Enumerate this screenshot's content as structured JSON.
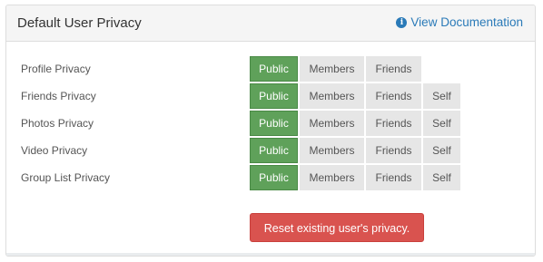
{
  "panel": {
    "title": "Default User Privacy",
    "doc_link": {
      "icon": "info-circle-icon",
      "label": "View Documentation"
    }
  },
  "privacy_rows": [
    {
      "label": "Profile Privacy",
      "options": [
        "Public",
        "Members",
        "Friends"
      ],
      "selected": "Public"
    },
    {
      "label": "Friends Privacy",
      "options": [
        "Public",
        "Members",
        "Friends",
        "Self"
      ],
      "selected": "Public"
    },
    {
      "label": "Photos Privacy",
      "options": [
        "Public",
        "Members",
        "Friends",
        "Self"
      ],
      "selected": "Public"
    },
    {
      "label": "Video Privacy",
      "options": [
        "Public",
        "Members",
        "Friends",
        "Self"
      ],
      "selected": "Public"
    },
    {
      "label": "Group List Privacy",
      "options": [
        "Public",
        "Members",
        "Friends",
        "Self"
      ],
      "selected": "Public"
    }
  ],
  "reset_button": {
    "label": "Reset existing user's privacy."
  },
  "colors": {
    "active_option": "#5fa15a",
    "inactive_option": "#e6e6e6",
    "reset_button": "#d9534f",
    "link": "#2a7ab8"
  }
}
